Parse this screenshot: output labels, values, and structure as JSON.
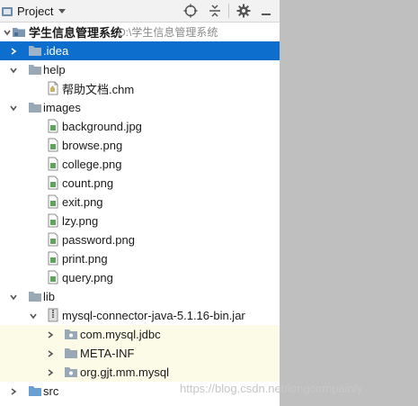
{
  "toolbar": {
    "project_label": "Project",
    "buttons": [
      "locate-icon",
      "collapse-all-icon",
      "gear-icon",
      "hide-icon"
    ]
  },
  "tree": {
    "root": {
      "name": "学生信息管理系统",
      "path": "D:\\学生信息管理系统"
    },
    "items": [
      {
        "label": ".idea",
        "type": "folder",
        "expanded": false,
        "selected": true
      },
      {
        "label": "help",
        "type": "folder",
        "expanded": true
      },
      {
        "label": "帮助文档.chm",
        "type": "file"
      },
      {
        "label": "images",
        "type": "folder",
        "expanded": true
      },
      {
        "label": "background.jpg",
        "type": "image"
      },
      {
        "label": "browse.png",
        "type": "image"
      },
      {
        "label": "college.png",
        "type": "image"
      },
      {
        "label": "count.png",
        "type": "image"
      },
      {
        "label": "exit.png",
        "type": "image"
      },
      {
        "label": "lzy.png",
        "type": "image"
      },
      {
        "label": "password.png",
        "type": "image"
      },
      {
        "label": "print.png",
        "type": "image"
      },
      {
        "label": "query.png",
        "type": "image"
      },
      {
        "label": "lib",
        "type": "folder",
        "expanded": true
      },
      {
        "label": "mysql-connector-java-5.1.16-bin.jar",
        "type": "jar",
        "expanded": true
      },
      {
        "label": "com.mysql.jdbc",
        "type": "package",
        "expanded": false
      },
      {
        "label": "META-INF",
        "type": "package",
        "expanded": false
      },
      {
        "label": "org.gjt.mm.mysql",
        "type": "package",
        "expanded": false
      },
      {
        "label": "src",
        "type": "source-folder",
        "expanded": false
      }
    ]
  },
  "watermark": "https://blog.csdn.net/longcompainly",
  "colors": {
    "selection": "#0e6ecd",
    "lib_highlight": "#fbfbe8",
    "empty_area": "#bfbfbf"
  }
}
